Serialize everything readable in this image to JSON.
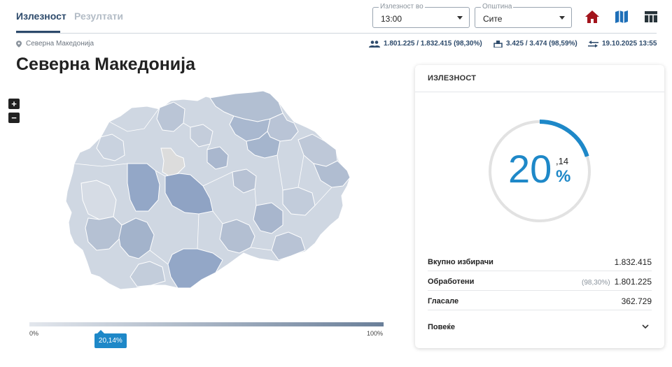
{
  "tabs": [
    {
      "label": "Излезност",
      "active": true
    },
    {
      "label": "Резултати",
      "active": false
    }
  ],
  "filters": {
    "time": {
      "legend": "Излезност во",
      "value": "13:00"
    },
    "municipality": {
      "legend": "Општина",
      "value": "Сите"
    }
  },
  "location": {
    "breadcrumb": "Северна Македонија"
  },
  "stats": {
    "voters": "1.801.225 / 1.832.415 (98,30%)",
    "stations": "3.425 / 3.474 (98,59%)",
    "updated": "19.10.2025 13:55"
  },
  "page_title": "Северна Македонија",
  "zoom": {
    "in": "+",
    "out": "−"
  },
  "scale": {
    "min": "0%",
    "max": "100%",
    "marker": "20,14%",
    "marker_fraction": 0.2014
  },
  "card": {
    "title": "ИЗЛЕЗНОСТ",
    "gauge": {
      "fraction": 0.2014,
      "integer": "20",
      "decimal": ",14",
      "unit": "%"
    },
    "rows": [
      {
        "label": "Вкупно избирачи",
        "sub": "",
        "value": "1.832.415"
      },
      {
        "label": "Обработени",
        "sub": "(98,30%)",
        "value": "1.801.225"
      },
      {
        "label": "Гласале",
        "sub": "",
        "value": "362.729"
      }
    ],
    "more": "Повеќе"
  },
  "colors": {
    "accent": "#1e88c8",
    "navy": "#2d4a6b",
    "home_icon": "#a3141c",
    "map_light": "#cfd7e2",
    "map_mid": "#b2bfd2",
    "map_dark": "#93a7c7",
    "map_grey": "#dcdcdc"
  }
}
